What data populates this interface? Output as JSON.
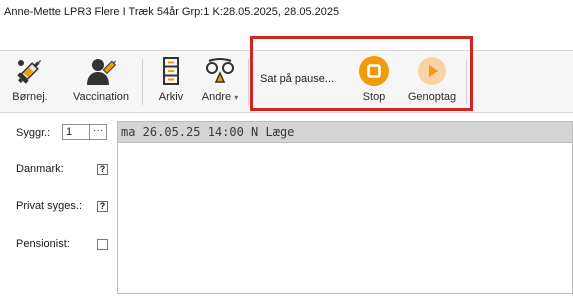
{
  "window": {
    "title": "Anne-Mette LPR3 Flere I Træk 54år Grp:1 K:28.05.2025, 28.05.2025"
  },
  "toolbar": {
    "bornej_label": "Børnej.",
    "vaccination_label": "Vaccination",
    "arkiv_label": "Arkiv",
    "andre_label": "Andre",
    "andre_arrow": "▾",
    "pause_status": "Sat på pause...",
    "stop_label": "Stop",
    "genoptag_label": "Genoptag",
    "accent_orange": "#f29b0a",
    "accent_light_orange": "#f7d4a8"
  },
  "form": {
    "syggr_label": "Syggr.:",
    "syggr_value": "1",
    "syggr_button": "···",
    "danmark_label": "Danmark:",
    "danmark_value": "?",
    "privat_label": "Privat syges.:",
    "privat_value": "?",
    "pensionist_label": "Pensionist:"
  },
  "journal": {
    "entry_header": "ma 26.05.25 14:00 N Læge"
  },
  "highlight": {
    "color": "#d42323"
  }
}
